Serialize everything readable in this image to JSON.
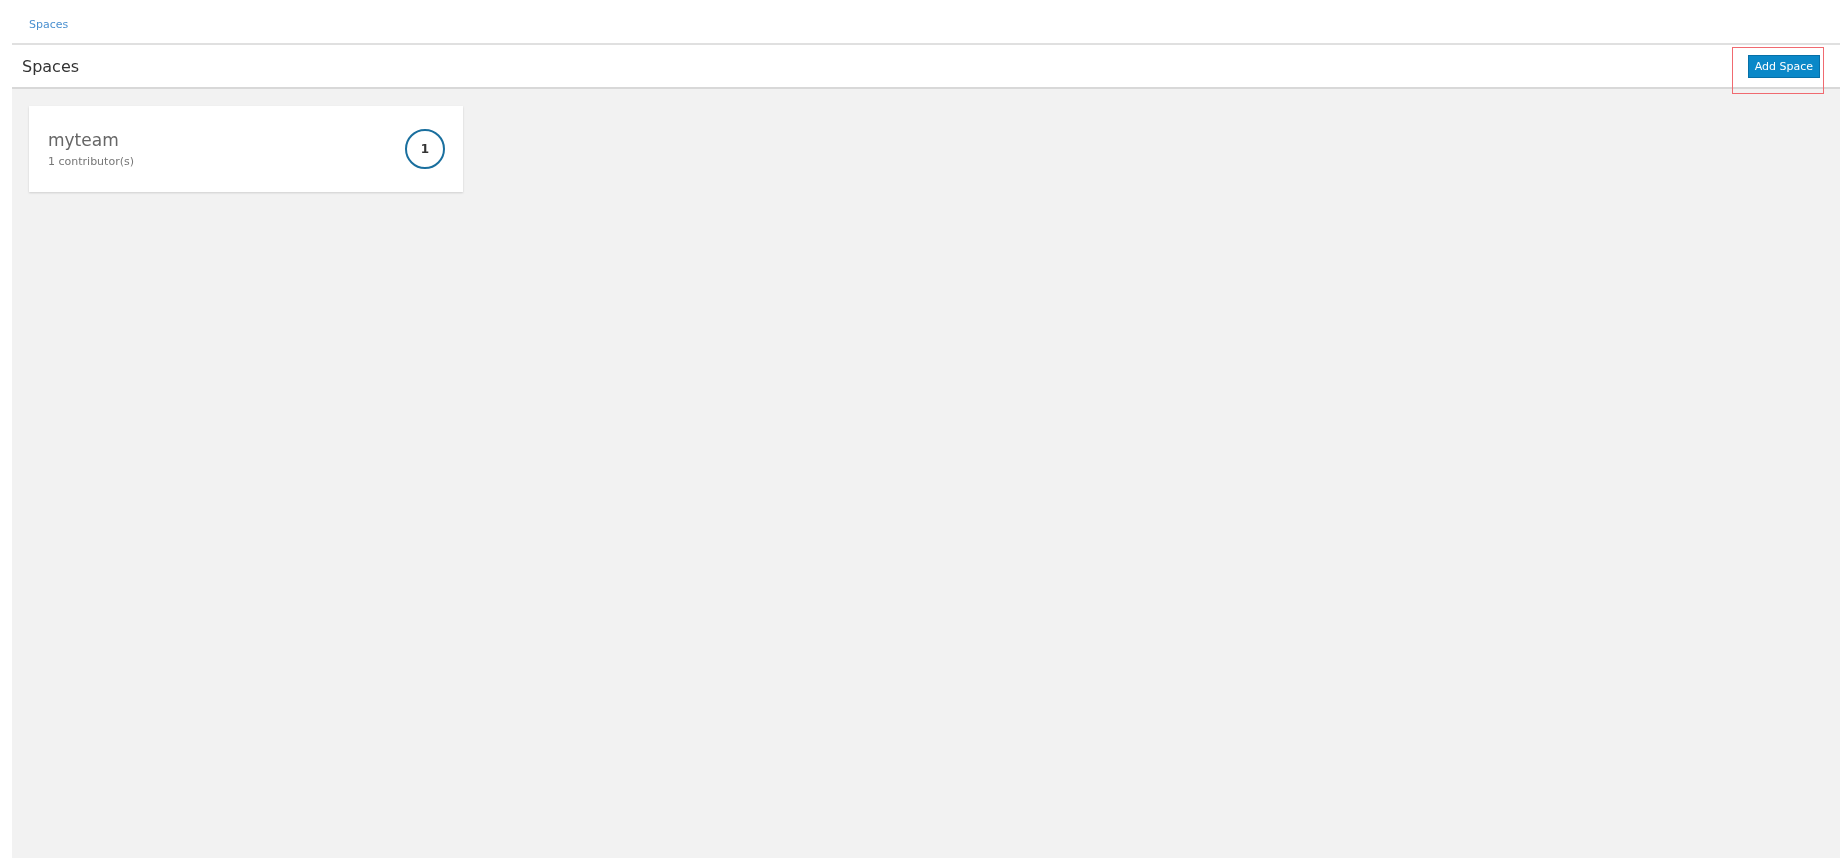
{
  "breadcrumb": {
    "label": "Spaces"
  },
  "header": {
    "title": "Spaces",
    "button": {
      "label": "Add Space",
      "highlighted": true
    }
  },
  "spaces": [
    {
      "name": "myteam",
      "contributors": "1 contributor(s)",
      "count": "1"
    }
  ]
}
